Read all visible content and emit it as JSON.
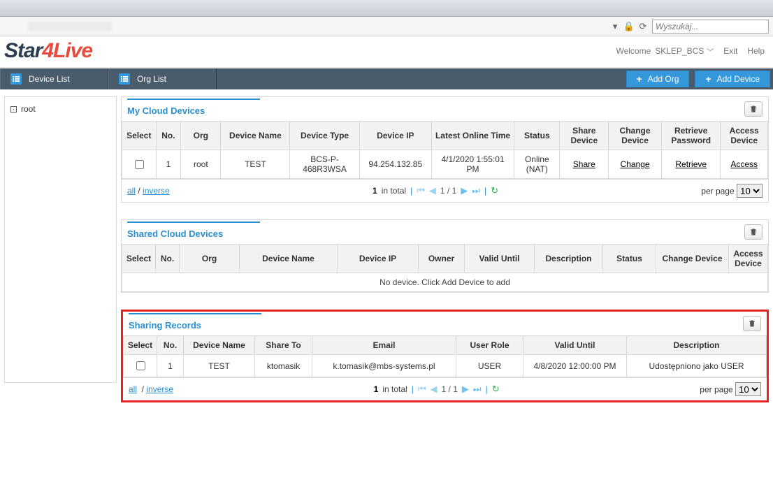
{
  "browser": {
    "search_placeholder": "Wyszukaj..."
  },
  "brand": {
    "part1": "Star",
    "part2": "4Live"
  },
  "user": {
    "welcome": "Welcome",
    "name": "SKLEP_BCS",
    "exit": "Exit",
    "help": "Help"
  },
  "nav": {
    "device_list": "Device List",
    "org_list": "Org List",
    "add_org": "Add Org",
    "add_device": "Add Device"
  },
  "tree": {
    "root": "root"
  },
  "panel1": {
    "title": "My Cloud Devices",
    "headers": {
      "select": "Select",
      "no": "No.",
      "org": "Org",
      "name": "Device Name",
      "type": "Device Type",
      "ip": "Device IP",
      "time": "Latest Online Time",
      "status": "Status",
      "share": "Share Device",
      "change": "Change Device",
      "retrieve": "Retrieve Password",
      "access": "Access Device"
    },
    "row": {
      "no": "1",
      "org": "root",
      "name": "TEST",
      "type": "BCS-P-468R3WSA",
      "ip": "94.254.132.85",
      "time": "4/1/2020 1:55:01 PM",
      "status": "Online (NAT)",
      "share": "Share",
      "change": "Change",
      "retrieve": "Retrieve",
      "access": "Access"
    }
  },
  "panel2": {
    "title": "Shared Cloud Devices",
    "headers": {
      "select": "Select",
      "no": "No.",
      "org": "Org",
      "name": "Device Name",
      "ip": "Device IP",
      "owner": "Owner",
      "valid": "Valid Until",
      "desc": "Description",
      "status": "Status",
      "change": "Change Device",
      "access": "Access Device"
    },
    "empty": "No device. Click Add Device to add"
  },
  "panel3": {
    "title": "Sharing Records",
    "headers": {
      "select": "Select",
      "no": "No.",
      "name": "Device Name",
      "shareto": "Share To",
      "email": "Email",
      "role": "User Role",
      "valid": "Valid Until",
      "desc": "Description"
    },
    "row": {
      "no": "1",
      "name": "TEST",
      "shareto": "ktomasik",
      "email": "k.tomasik@mbs-systems.pl",
      "role": "USER",
      "valid": "4/8/2020 12:00:00 PM",
      "desc": "Udostępniono jako USER"
    }
  },
  "pager": {
    "all": "all",
    "inverse": "inverse",
    "in_total_num": "1",
    "in_total_txt": " in total",
    "page": "1 / 1",
    "per_page": "per page",
    "options": [
      "10"
    ],
    "selected": "10"
  }
}
